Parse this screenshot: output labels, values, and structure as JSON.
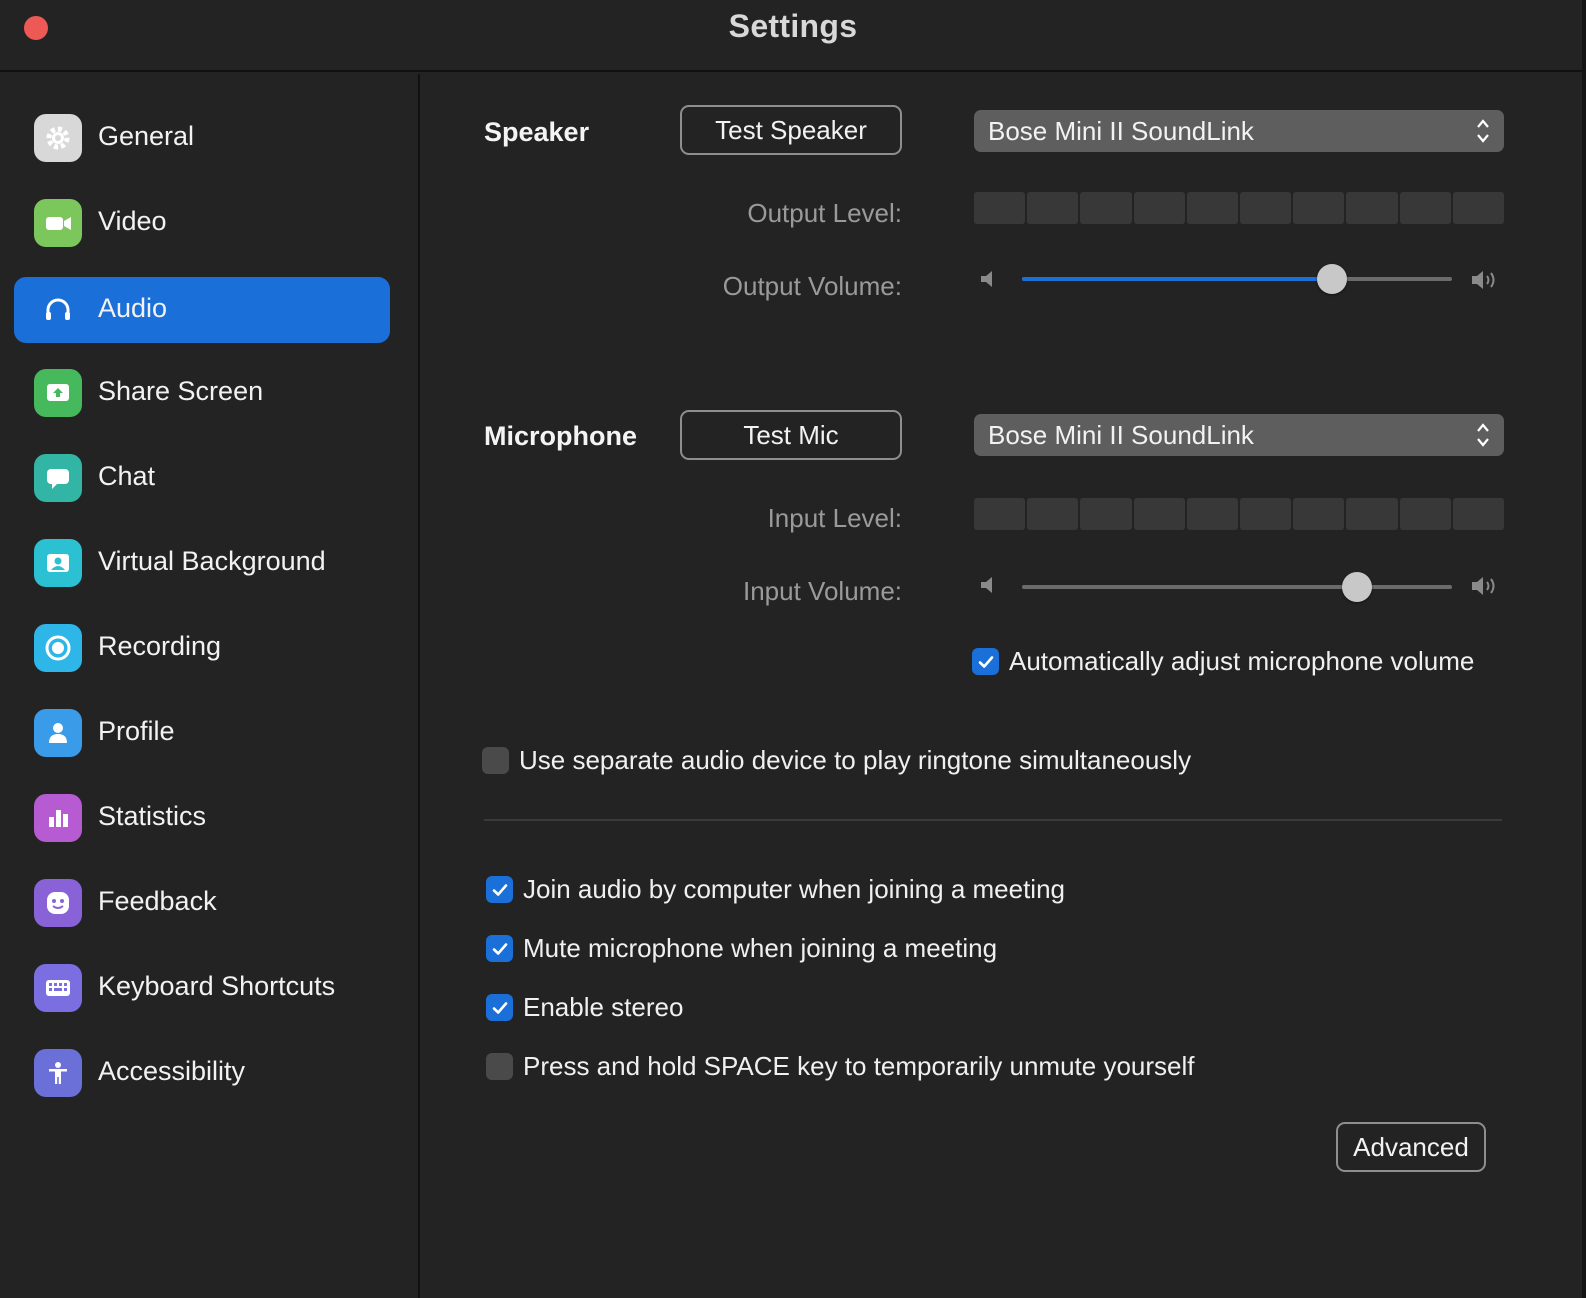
{
  "window": {
    "title": "Settings"
  },
  "sidebar": {
    "items": [
      {
        "label": "General",
        "icon": "gear-icon",
        "color": "#d8d8d8"
      },
      {
        "label": "Video",
        "icon": "video-camera-icon",
        "color": "#7cc75b"
      },
      {
        "label": "Audio",
        "icon": "headphones-icon",
        "color": "#1a6fd8",
        "active": true
      },
      {
        "label": "Share Screen",
        "icon": "share-screen-icon",
        "color": "#45b95c"
      },
      {
        "label": "Chat",
        "icon": "chat-bubble-icon",
        "color": "#33b5a6"
      },
      {
        "label": "Virtual Background",
        "icon": "virtual-background-icon",
        "color": "#2cc0d3"
      },
      {
        "label": "Recording",
        "icon": "record-icon",
        "color": "#2fb6e8"
      },
      {
        "label": "Profile",
        "icon": "profile-icon",
        "color": "#3a9be8"
      },
      {
        "label": "Statistics",
        "icon": "bar-chart-icon",
        "color": "#b65bd1"
      },
      {
        "label": "Feedback",
        "icon": "smiley-icon",
        "color": "#8a62d8"
      },
      {
        "label": "Keyboard Shortcuts",
        "icon": "keyboard-icon",
        "color": "#7a6ee0"
      },
      {
        "label": "Accessibility",
        "icon": "accessibility-icon",
        "color": "#6b70d8"
      }
    ]
  },
  "speaker": {
    "label": "Speaker",
    "test_button": "Test Speaker",
    "device": "Bose Mini II SoundLink",
    "output_level_label": "Output Level:",
    "output_volume_label": "Output Volume:",
    "output_volume": 0.72
  },
  "microphone": {
    "label": "Microphone",
    "test_button": "Test Mic",
    "device": "Bose Mini II SoundLink",
    "input_level_label": "Input Level:",
    "input_volume_label": "Input Volume:",
    "input_volume": 0.78,
    "auto_adjust_label": "Automatically adjust microphone volume",
    "auto_adjust": true
  },
  "options": {
    "separate_ringtone": {
      "label": "Use separate audio device to play ringtone simultaneously",
      "checked": false
    },
    "join_audio": {
      "label": "Join audio by computer when joining a meeting",
      "checked": true
    },
    "mute_mic": {
      "label": "Mute microphone when joining a meeting",
      "checked": true
    },
    "enable_stereo": {
      "label": "Enable stereo",
      "checked": true
    },
    "space_unmute": {
      "label": "Press and hold SPACE key to temporarily unmute yourself",
      "checked": false
    }
  },
  "advanced_button": "Advanced",
  "colors": {
    "accent": "#1a6fd8",
    "background": "#232323",
    "close": "#ed5a55"
  }
}
